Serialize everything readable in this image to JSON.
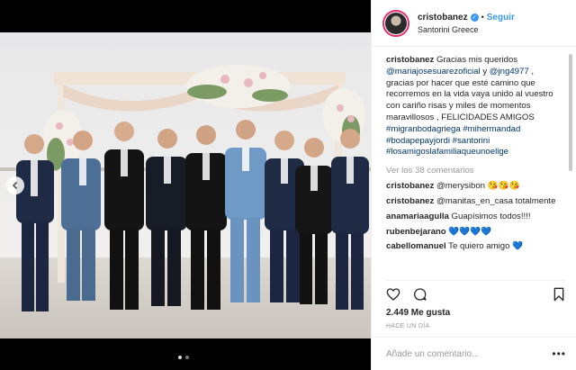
{
  "header": {
    "username": "cristobanez",
    "separator": "•",
    "follow_label": "Seguir",
    "location": "Santorini Greece"
  },
  "caption": {
    "username": "cristobanez",
    "text1": "Gracias mis queridos",
    "mention1": "@mariajosesuarezoficial",
    "and": "y",
    "mention2": "@jng4977",
    "text2": ", gracias por hacer que esté camino que recorremos en la vida vaya unido al vuestro con cariño risas y miles de momentos maravillosos , FELICIDADES AMIGOS",
    "hashtags": [
      "#migranbodagriega",
      "#mihermandad",
      "#bodapepayjordi",
      "#santorini",
      "#losamigoslafamiliaqueunoelige"
    ]
  },
  "more_comments": "Ver los 38 comentarios",
  "comments": [
    {
      "user": "cristobanez",
      "text": "@merysibon 😘😘😘"
    },
    {
      "user": "cristobanez",
      "text": "@manitas_en_casa totalmente"
    },
    {
      "user": "anamariaagulla",
      "text": "Guapísimos todos!!!!"
    },
    {
      "user": "rubenbejarano",
      "text": "💙💙💙💙"
    },
    {
      "user": "cabellomanuel",
      "text": "Te quiero amigo 💙"
    }
  ],
  "likes": "2.449 Me gusta",
  "time_ago": "HACE UN DÍA",
  "comment_input": {
    "placeholder": "Añade un comentario..."
  },
  "more_menu": "•••",
  "colors": {
    "accent": "#3897f0",
    "link": "#003569",
    "muted": "#999999"
  },
  "icons": [
    "chevron-left-icon",
    "heart-icon",
    "comment-icon",
    "bookmark-icon",
    "verified-icon"
  ]
}
